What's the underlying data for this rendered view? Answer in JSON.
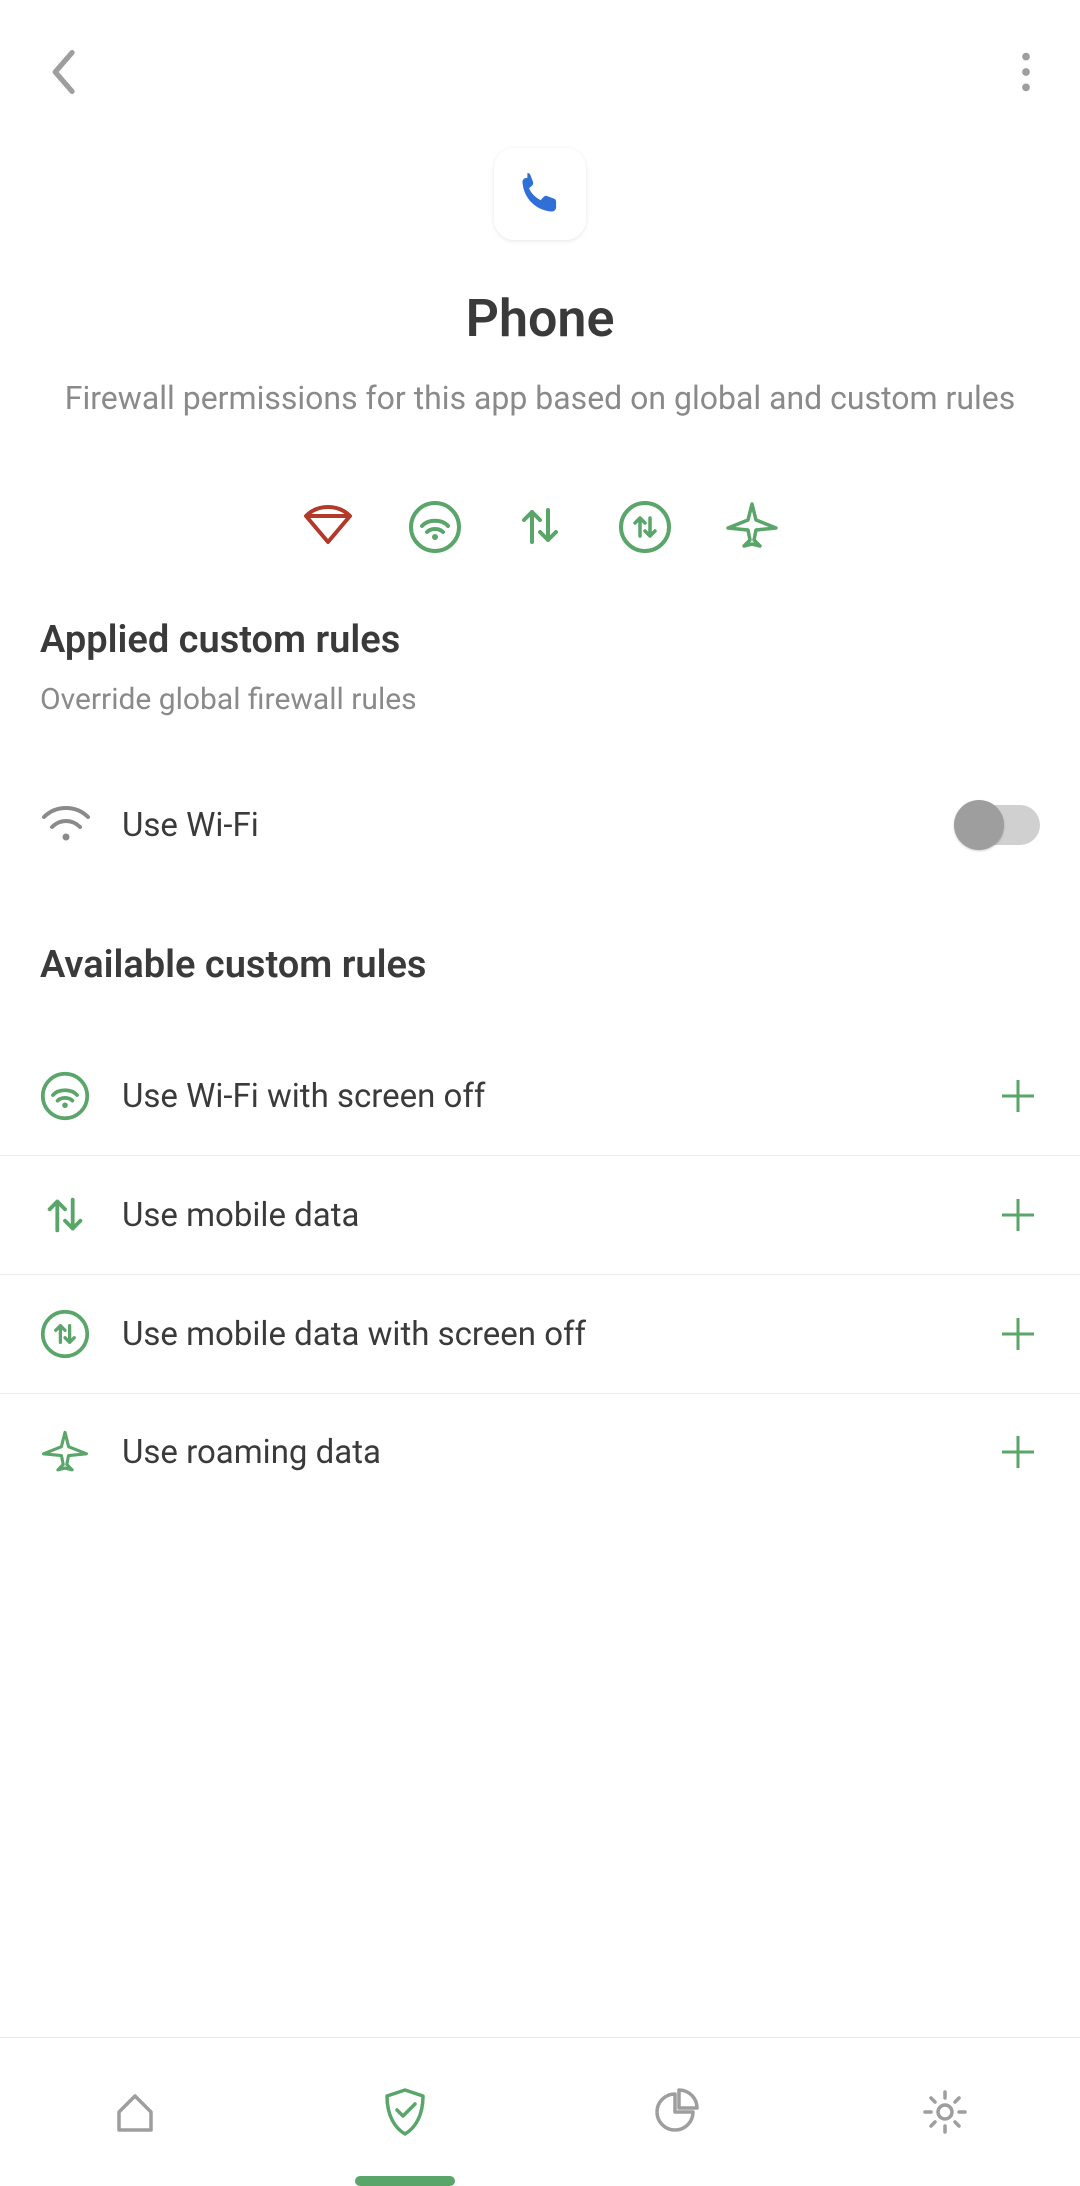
{
  "colors": {
    "green": "#5aa569",
    "red": "#b33a2a",
    "gray": "#8a8a8a",
    "icon_gray": "#9e9e9e",
    "blue": "#2f6fd6"
  },
  "app": {
    "name": "Phone",
    "subtitle": "Firewall permissions for this app based on global and custom rules"
  },
  "status_icons": [
    {
      "name": "wifi-blocked-icon",
      "state": "blocked"
    },
    {
      "name": "wifi-screen-off-icon",
      "state": "allowed"
    },
    {
      "name": "mobile-data-icon",
      "state": "allowed"
    },
    {
      "name": "mobile-data-screen-off-icon",
      "state": "allowed"
    },
    {
      "name": "roaming-icon",
      "state": "allowed"
    }
  ],
  "sections": {
    "applied": {
      "title": "Applied custom rules",
      "subtitle": "Override global firewall rules",
      "rules": [
        {
          "label": "Use Wi-Fi",
          "icon": "wifi-icon",
          "toggle": false
        }
      ]
    },
    "available": {
      "title": "Available custom rules",
      "rules": [
        {
          "label": "Use Wi-Fi with screen off",
          "icon": "wifi-screen-off-icon"
        },
        {
          "label": "Use mobile data",
          "icon": "mobile-data-icon"
        },
        {
          "label": "Use mobile data with screen off",
          "icon": "mobile-data-screen-off-icon"
        },
        {
          "label": "Use roaming data",
          "icon": "roaming-icon"
        }
      ]
    }
  },
  "nav": {
    "items": [
      "home",
      "shield",
      "stats",
      "settings"
    ],
    "active": 1
  }
}
